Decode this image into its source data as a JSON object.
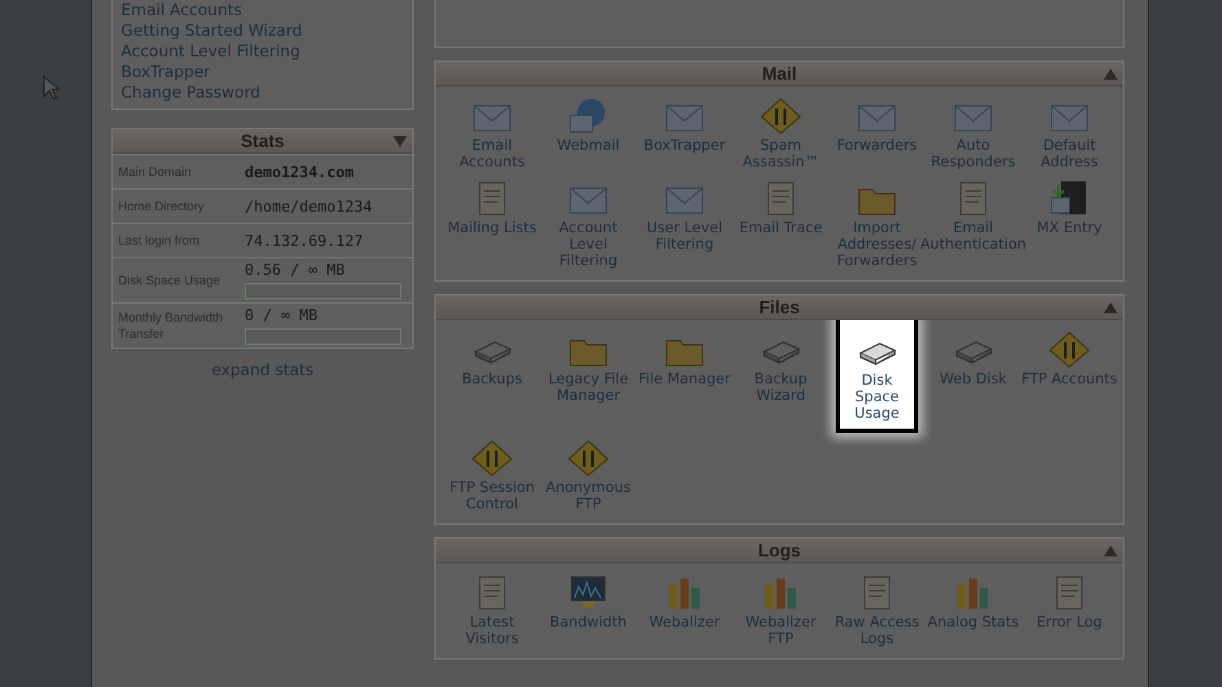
{
  "left_links": [
    "Email Accounts",
    "Getting Started Wizard",
    "Account Level Filtering",
    "BoxTrapper",
    "Change Password"
  ],
  "stats": {
    "title": "Stats",
    "rows": [
      {
        "label": "Main Domain",
        "value": "demo1234.com",
        "kind": "strong"
      },
      {
        "label": "Home Directory",
        "value": "/home/demo1234",
        "kind": "plain"
      },
      {
        "label": "Last login from",
        "value": "74.132.69.127",
        "kind": "plain"
      },
      {
        "label": "Disk Space Usage",
        "value": "0.56 / ∞ MB",
        "kind": "usage",
        "level": 0
      },
      {
        "label": "Monthly Bandwidth Transfer",
        "value": "0 / ∞ MB",
        "kind": "usage",
        "level": 0
      }
    ],
    "expand": "expand stats"
  },
  "sections": [
    {
      "title": "Mail",
      "items": [
        {
          "label": "Email Accounts",
          "selected": false
        },
        {
          "label": "Webmail",
          "selected": false
        },
        {
          "label": "BoxTrapper",
          "selected": false
        },
        {
          "label": "Spam Assassin™",
          "selected": false
        },
        {
          "label": "Forwarders",
          "selected": false
        },
        {
          "label": "Auto Responders",
          "selected": false
        },
        {
          "label": "Default Address",
          "selected": false
        },
        {
          "label": "Mailing Lists",
          "selected": false
        },
        {
          "label": "Account Level Filtering",
          "selected": false
        },
        {
          "label": "User Level Filtering",
          "selected": false
        },
        {
          "label": "Email Trace",
          "selected": false
        },
        {
          "label": "Import Addresses/ Forwarders",
          "selected": false
        },
        {
          "label": "Email Authentication",
          "selected": false
        },
        {
          "label": "MX Entry",
          "selected": false
        }
      ]
    },
    {
      "title": "Files",
      "items": [
        {
          "label": "Backups",
          "selected": false
        },
        {
          "label": "Legacy File Manager",
          "selected": false
        },
        {
          "label": "File Manager",
          "selected": false
        },
        {
          "label": "Backup Wizard",
          "selected": false
        },
        {
          "label": "Disk Space Usage",
          "selected": true
        },
        {
          "label": "Web Disk",
          "selected": false
        },
        {
          "label": "FTP Accounts",
          "selected": false
        },
        {
          "label": "FTP Session Control",
          "selected": false
        },
        {
          "label": "Anonymous FTP",
          "selected": false
        }
      ]
    },
    {
      "title": "Logs",
      "items": [
        {
          "label": "Latest Visitors",
          "selected": false
        },
        {
          "label": "Bandwidth",
          "selected": false
        },
        {
          "label": "Webalizer",
          "selected": false
        },
        {
          "label": "Webalizer FTP",
          "selected": false
        },
        {
          "label": "Raw Access Logs",
          "selected": false
        },
        {
          "label": "Analog Stats",
          "selected": false
        },
        {
          "label": "Error Log",
          "selected": false
        }
      ]
    }
  ]
}
